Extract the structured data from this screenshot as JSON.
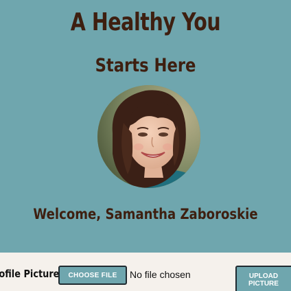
{
  "hero": {
    "headline": "A Healthy You",
    "subheadline": "Starts Here",
    "avatar_alt": "profile photo",
    "welcome": "Welcome, Samantha Zaboroskie"
  },
  "upload": {
    "label": "rofile Picture",
    "choose_button": "CHOOSE FILE",
    "file_status": "No file chosen",
    "upload_button_line1": "UPLOAD",
    "upload_button_line2": "PICTURE"
  },
  "colors": {
    "background": "#6fa6ae",
    "heading_text": "#3e1f10",
    "upload_bar": "#f5f1ec",
    "button_border": "#1f2a30"
  }
}
